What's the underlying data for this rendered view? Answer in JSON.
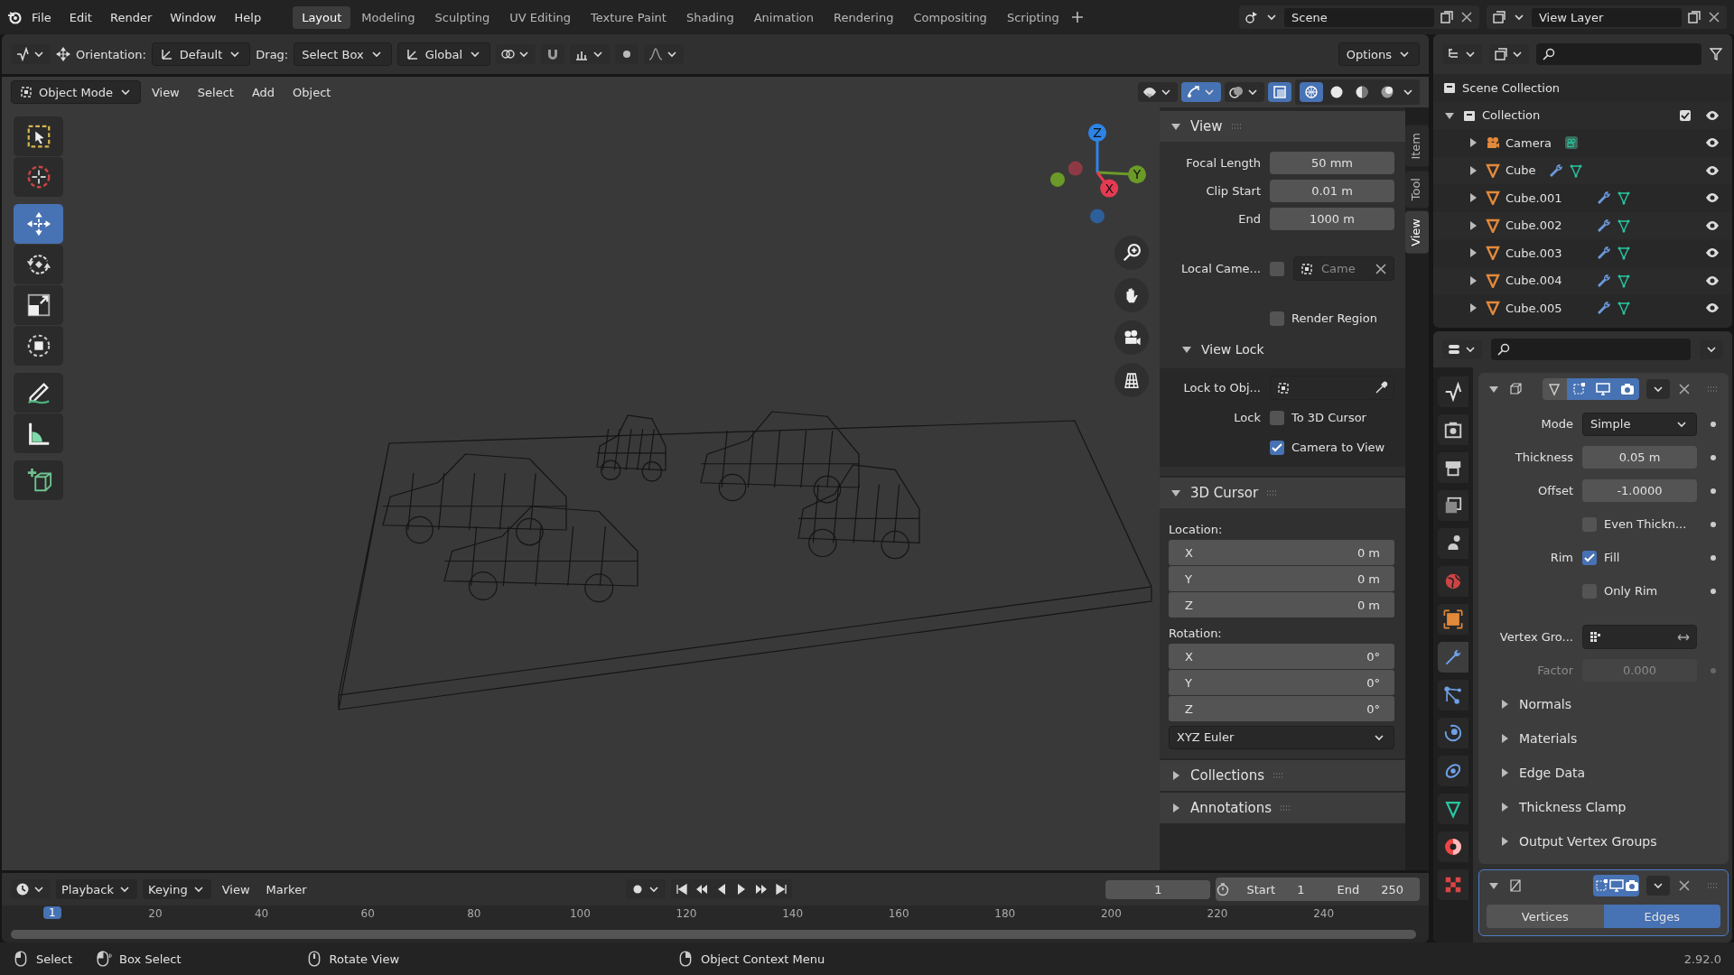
{
  "menu": [
    "File",
    "Edit",
    "Render",
    "Window",
    "Help"
  ],
  "workspaces": [
    {
      "label": "Layout",
      "selected": true
    },
    {
      "label": "Modeling",
      "selected": false
    },
    {
      "label": "Sculpting",
      "selected": false
    },
    {
      "label": "UV Editing",
      "selected": false
    },
    {
      "label": "Texture Paint",
      "selected": false
    },
    {
      "label": "Shading",
      "selected": false
    },
    {
      "label": "Animation",
      "selected": false
    },
    {
      "label": "Rendering",
      "selected": false
    },
    {
      "label": "Compositing",
      "selected": false
    },
    {
      "label": "Scripting",
      "selected": false
    }
  ],
  "scene": "Scene",
  "view_layer": "View Layer",
  "tool_settings": {
    "orientation_label": "Orientation:",
    "orientation": "Default",
    "drag_label": "Drag:",
    "drag": "Select Box",
    "transform_orientation": "Global",
    "options": "Options"
  },
  "viewport_header": {
    "mode": "Object Mode",
    "menus": [
      "View",
      "Select",
      "Add",
      "Object"
    ],
    "shading": [
      {
        "kind": "wireframe",
        "selected": true
      },
      {
        "kind": "solid",
        "selected": false
      },
      {
        "kind": "material",
        "selected": false
      },
      {
        "kind": "rendered",
        "selected": false
      }
    ]
  },
  "toolbar": [
    {
      "tools": [
        {
          "kind": "select",
          "selected": false
        },
        {
          "kind": "cursor",
          "selected": false
        }
      ]
    },
    {
      "tools": [
        {
          "kind": "move",
          "selected": true
        },
        {
          "kind": "rotate",
          "selected": false
        },
        {
          "kind": "scale",
          "selected": false
        },
        {
          "kind": "transform",
          "selected": false
        }
      ]
    },
    {
      "tools": [
        {
          "kind": "annotate",
          "selected": false
        },
        {
          "kind": "measure",
          "selected": false
        }
      ]
    },
    {
      "tools": [
        {
          "kind": "add-cube",
          "selected": false
        }
      ]
    }
  ],
  "gizmo": [
    {
      "kind": "negative",
      "color": "#8e3a46"
    },
    {
      "kind": "negative",
      "color": "#6b9a28"
    },
    {
      "kind": "negative",
      "color": "#2d5f9a"
    },
    {
      "kind": "positive",
      "label": "Z",
      "color": "#2e84e6"
    },
    {
      "kind": "positive",
      "label": "Y",
      "color": "#6b9a28"
    },
    {
      "kind": "positive",
      "label": "X",
      "color": "#e63a52"
    }
  ],
  "sidebar": {
    "tabs": [
      {
        "label": "Item",
        "selected": false
      },
      {
        "label": "Tool",
        "selected": false
      },
      {
        "label": "View",
        "selected": true
      }
    ],
    "panels": [
      {
        "title": "View",
        "expanded": true,
        "rows": [
          {
            "kind": "field",
            "label": "Focal Length",
            "value": "50 mm"
          },
          {
            "kind": "field",
            "label": "Clip Start",
            "value": "0.01 m"
          },
          {
            "kind": "field",
            "label": "End",
            "value": "1000 m"
          },
          {
            "kind": "local_camera",
            "label": "Local Came...",
            "checked": false,
            "value": "Came"
          },
          {
            "kind": "checkbox",
            "text": "Render Region",
            "checked": false
          },
          {
            "kind": "subpanel",
            "title": "View Lock",
            "expanded": true,
            "rows": [
              {
                "kind": "picker",
                "label": "Lock to Obj..."
              },
              {
                "kind": "checkbox",
                "label": "Lock",
                "text": "To 3D Cursor",
                "checked": false
              },
              {
                "kind": "checkbox",
                "text": "Camera to View",
                "checked": true
              }
            ]
          }
        ]
      },
      {
        "title": "3D Cursor",
        "expanded": true,
        "rows": [
          {
            "kind": "heading",
            "text": "Location:"
          },
          {
            "kind": "vector",
            "items": [
              {
                "axis": "X",
                "value": "0 m"
              },
              {
                "axis": "Y",
                "value": "0 m"
              },
              {
                "axis": "Z",
                "value": "0 m"
              }
            ]
          },
          {
            "kind": "heading",
            "text": "Rotation:"
          },
          {
            "kind": "vector",
            "items": [
              {
                "axis": "X",
                "value": "0°"
              },
              {
                "axis": "Y",
                "value": "0°"
              },
              {
                "axis": "Z",
                "value": "0°"
              }
            ]
          },
          {
            "kind": "dropdown",
            "value": "XYZ Euler"
          }
        ]
      },
      {
        "title": "Collections",
        "expanded": false
      },
      {
        "title": "Annotations",
        "expanded": false
      }
    ]
  },
  "outliner": {
    "root": "Scene Collection",
    "collections": [
      {
        "name": "Collection",
        "expanded": true,
        "checked": true,
        "children": [
          {
            "name": "Camera",
            "kind": "camera",
            "expanded": false
          },
          {
            "name": "Cube",
            "kind": "mesh",
            "expanded": false
          },
          {
            "name": "Cube.001",
            "kind": "mesh",
            "expanded": false
          },
          {
            "name": "Cube.002",
            "kind": "mesh",
            "expanded": false
          },
          {
            "name": "Cube.003",
            "kind": "mesh",
            "expanded": false
          },
          {
            "name": "Cube.004",
            "kind": "mesh",
            "expanded": false
          },
          {
            "name": "Cube.005",
            "kind": "mesh",
            "expanded": false
          }
        ]
      }
    ]
  },
  "properties": {
    "tabs": [
      {
        "kind": "tool",
        "selected": false
      },
      {
        "kind": "render",
        "selected": false
      },
      {
        "kind": "output",
        "selected": false
      },
      {
        "kind": "view-layer",
        "selected": false
      },
      {
        "kind": "scene",
        "selected": false
      },
      {
        "kind": "world",
        "selected": false
      },
      {
        "kind": "object",
        "selected": false
      },
      {
        "kind": "modifier",
        "selected": true
      },
      {
        "kind": "particles",
        "selected": false
      },
      {
        "kind": "physics",
        "selected": false
      },
      {
        "kind": "constraints",
        "selected": false
      },
      {
        "kind": "data",
        "selected": false
      },
      {
        "kind": "material",
        "selected": false
      },
      {
        "kind": "texture",
        "selected": false
      }
    ],
    "modifiers": [
      {
        "kind": "solidify",
        "expanded": true,
        "active": false,
        "toggles": [
          {
            "kind": "cage",
            "on": false
          },
          {
            "kind": "editmode",
            "on": true
          },
          {
            "kind": "viewport",
            "on": true
          },
          {
            "kind": "render",
            "on": true
          }
        ],
        "rows": [
          {
            "kind": "dropdown",
            "label": "Mode",
            "value": "Simple",
            "disabled": false
          },
          {
            "kind": "field",
            "label": "Thickness",
            "value": "0.05 m",
            "disabled": false
          },
          {
            "kind": "field",
            "label": "Offset",
            "value": "-1.0000",
            "disabled": false
          },
          {
            "kind": "checkbox",
            "text": "Even Thickn...",
            "checked": false,
            "disabled": false
          },
          {
            "kind": "checkbox",
            "label": "Rim",
            "text": "Fill",
            "checked": true,
            "disabled": false
          },
          {
            "kind": "checkbox",
            "text": "Only Rim",
            "checked": false,
            "disabled": false
          },
          {
            "kind": "vgroup",
            "label": "Vertex Gro...",
            "disabled": false
          },
          {
            "kind": "field",
            "label": "Factor",
            "value": "0.000",
            "disabled": true
          },
          {
            "kind": "subpanel",
            "title": "Normals",
            "expanded": false,
            "disabled": false
          },
          {
            "kind": "subpanel",
            "title": "Materials",
            "expanded": false,
            "disabled": false
          },
          {
            "kind": "subpanel",
            "title": "Edge Data",
            "expanded": false,
            "disabled": false
          },
          {
            "kind": "subpanel",
            "title": "Thickness Clamp",
            "expanded": false,
            "disabled": false
          },
          {
            "kind": "subpanel",
            "title": "Output Vertex Groups",
            "expanded": false,
            "disabled": false
          }
        ]
      },
      {
        "kind": "wireframe",
        "expanded": true,
        "active": true,
        "toggles": [
          {
            "kind": "editmode",
            "on": true
          },
          {
            "kind": "viewport",
            "on": true
          },
          {
            "kind": "render",
            "on": true
          }
        ],
        "segments": [
          {
            "label": "Vertices",
            "selected": false
          },
          {
            "label": "Edges",
            "selected": true
          }
        ]
      }
    ]
  },
  "timeline": {
    "menus": [
      {
        "label": "Playback",
        "dropdown": true
      },
      {
        "label": "Keying",
        "dropdown": true
      },
      {
        "label": "View",
        "dropdown": false
      },
      {
        "label": "Marker",
        "dropdown": false
      }
    ],
    "current_frame": "1",
    "start_label": "Start",
    "start": "1",
    "end_label": "End",
    "end": "250",
    "playhead": "1",
    "ticks": [
      "20",
      "40",
      "60",
      "80",
      "100",
      "120",
      "140",
      "160",
      "180",
      "200",
      "220",
      "240"
    ]
  },
  "status_bar": {
    "hints": [
      {
        "kind": "left",
        "text": "Select"
      },
      {
        "kind": "drag",
        "text": "Box Select"
      },
      {
        "kind": "middle",
        "text": "Rotate View"
      },
      {
        "kind": "right",
        "text": "Object Context Menu"
      }
    ],
    "version": "2.92.0"
  }
}
